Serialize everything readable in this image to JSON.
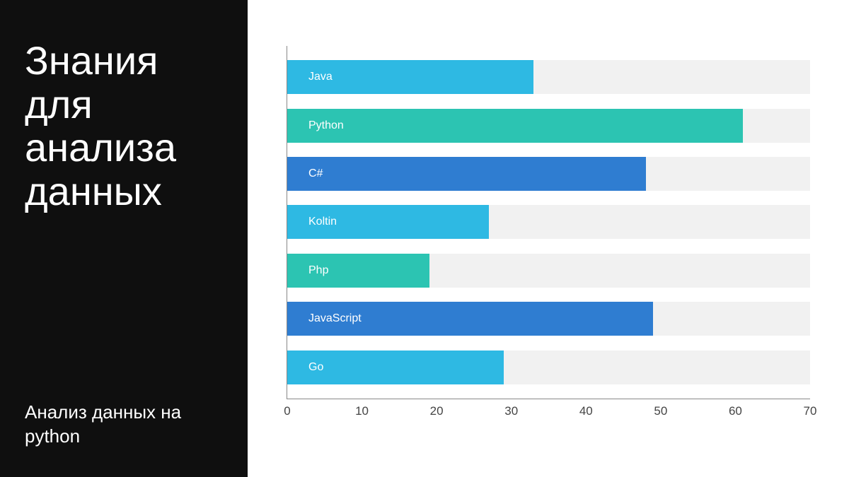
{
  "sidebar": {
    "title": "Знания для анализа данных",
    "subtitle": "Анализ данных на python"
  },
  "chart_data": {
    "type": "bar",
    "orientation": "horizontal",
    "xlabel": "",
    "ylabel": "",
    "xlim": [
      0,
      70
    ],
    "xticks": [
      0,
      10,
      20,
      30,
      40,
      50,
      60,
      70
    ],
    "categories": [
      "Java",
      "Python",
      "C#",
      "Koltin",
      "Php",
      "JavaScript",
      "Go"
    ],
    "values": [
      33,
      61,
      48,
      27,
      19,
      49,
      29
    ],
    "colors": [
      "#2eb9e3",
      "#2cc4b2",
      "#2f7dd1",
      "#2eb9e3",
      "#2cc4b2",
      "#2f7dd1",
      "#2eb9e3"
    ],
    "track_color": "#f1f1f1"
  }
}
